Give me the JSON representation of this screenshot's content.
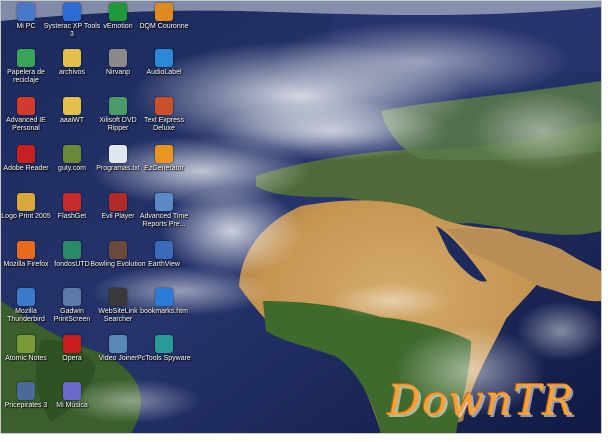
{
  "desktop": {
    "icons": [
      {
        "label": "Mi PC",
        "icon": "computer-icon",
        "color": "#4a78c8"
      },
      {
        "label": "Systerac XP Tools 3",
        "icon": "tools-icon",
        "color": "#2b6cd6"
      },
      {
        "label": "vEmotion",
        "icon": "brazil-flag-icon",
        "color": "#1f9a3a"
      },
      {
        "label": "DQM Couronne",
        "icon": "crown-icon",
        "color": "#e08a1e"
      },
      {
        "label": "Papelera de reciclaje",
        "icon": "recycle-bin-icon",
        "color": "#3aa35a"
      },
      {
        "label": "archivos",
        "icon": "folder-icon",
        "color": "#e3c04a"
      },
      {
        "label": "Nirvanp",
        "icon": "disc-icon",
        "color": "#8a8a8a"
      },
      {
        "label": "AudioLabel",
        "icon": "audio-icon",
        "color": "#2a8ad8"
      },
      {
        "label": "Advanced IE Personal",
        "icon": "shield-icon",
        "color": "#d23a2a"
      },
      {
        "label": "aaaiWT",
        "icon": "folder-icon",
        "color": "#e3c04a"
      },
      {
        "label": "Xilisoft DVD Ripper",
        "icon": "dvd-icon",
        "color": "#4a9a6a"
      },
      {
        "label": "Text Express Deluxe",
        "icon": "text-icon",
        "color": "#c8502a"
      },
      {
        "label": "Adobe Reader",
        "icon": "pdf-icon",
        "color": "#c8201e"
      },
      {
        "label": "guty.com",
        "icon": "document-icon",
        "color": "#6a8a3a"
      },
      {
        "label": "Programas.txt",
        "icon": "text-file-icon",
        "color": "#dfe6ee"
      },
      {
        "label": "EzGenerator",
        "icon": "generator-icon",
        "color": "#e8961e"
      },
      {
        "label": "Logo Print 2005",
        "icon": "print-icon",
        "color": "#d8a83a"
      },
      {
        "label": "FlashGet",
        "icon": "download-icon",
        "color": "#c82a2a"
      },
      {
        "label": "Evil Player",
        "icon": "player-icon",
        "color": "#b02a2a"
      },
      {
        "label": "Advanced Time Reports Pre...",
        "icon": "clock-icon",
        "color": "#5a8ac8"
      },
      {
        "label": "Mozilla Firefox",
        "icon": "firefox-icon",
        "color": "#e86a1e"
      },
      {
        "label": "fondosUTD",
        "icon": "photo-icon",
        "color": "#2a8a6a"
      },
      {
        "label": "Bowling Evolution",
        "icon": "bowling-icon",
        "color": "#6a4a3a"
      },
      {
        "label": "EarthView",
        "icon": "globe-icon",
        "color": "#3a6ab8"
      },
      {
        "label": "Mozilla Thunderbird",
        "icon": "mail-icon",
        "color": "#3a7ac8"
      },
      {
        "label": "Gadwin PrintScreen",
        "icon": "camera-icon",
        "color": "#5a7aa8"
      },
      {
        "label": "WebSiteLink Searcher",
        "icon": "web-icon",
        "color": "#3a3a3a"
      },
      {
        "label": "bookmarks.htm",
        "icon": "ie-file-icon",
        "color": "#2a7ad8"
      },
      {
        "label": "Atomic Notes",
        "icon": "notes-icon",
        "color": "#7a9a3a"
      },
      {
        "label": "Opera",
        "icon": "opera-icon",
        "color": "#c81e1e"
      },
      {
        "label": "Video Joiner",
        "icon": "video-icon",
        "color": "#5a8ab8"
      },
      {
        "label": "PcTools Spyware",
        "icon": "scan-icon",
        "color": "#2a9a9a"
      },
      {
        "label": "Pricepirates 3",
        "icon": "pirate-icon",
        "color": "#4a6a9a"
      },
      {
        "label": "Mi Música",
        "icon": "music-icon",
        "color": "#6a6ac8"
      }
    ]
  },
  "watermark": {
    "text": "DownTR"
  }
}
